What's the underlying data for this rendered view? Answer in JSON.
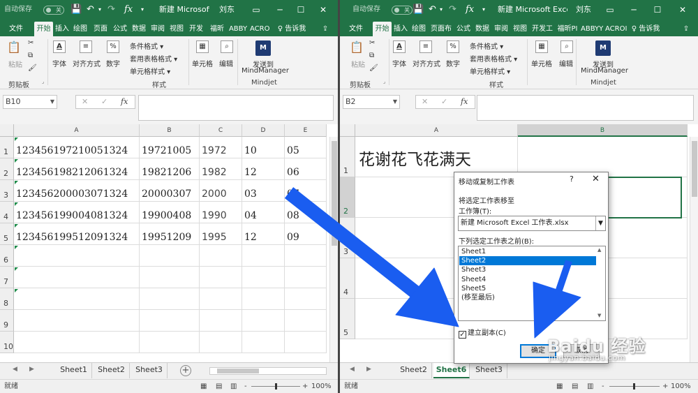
{
  "left": {
    "title": {
      "autosave": "自动保存",
      "toggle": "关",
      "save_icon": "save-icon",
      "undo": "↶",
      "undo_dd": "▾",
      "redo": "↷",
      "fx": "fx",
      "more": "▾",
      "doc": "新建 Microsoft",
      "user": "刘东",
      "win_opts": "▭",
      "minimize": "─",
      "maximize": "☐",
      "close": "✕"
    },
    "tabs": [
      {
        "label": "文件"
      },
      {
        "label": "开始"
      },
      {
        "label": "插入"
      },
      {
        "label": "绘图"
      },
      {
        "label": "页面"
      },
      {
        "label": "公式"
      },
      {
        "label": "数据"
      },
      {
        "label": "审阅"
      },
      {
        "label": "视图"
      },
      {
        "label": "开发"
      },
      {
        "label": "福昕"
      },
      {
        "label": "ABBY"
      },
      {
        "label": "ACRO"
      }
    ],
    "tell_me": "♀ 告诉我",
    "share_icon": "⇪",
    "ribbon": {
      "paste": "粘贴",
      "clipboard": "剪贴板",
      "font": "字体",
      "align": "对齐方式",
      "number": "数字",
      "cond_fmt": "条件格式 ▾",
      "table_fmt": "套用表格格式 ▾",
      "cell_style": "单元格样式 ▾",
      "styles": "样式",
      "cells": "单元格",
      "edit": "编辑",
      "send_line1": "发送到",
      "send_line2": "MindManager",
      "mindjet": "Mindjet"
    },
    "formula": {
      "namebox": "B10",
      "cancel": "✕",
      "enter": "✓",
      "fx": "fx"
    },
    "columns": [
      "A",
      "B",
      "C",
      "D",
      "E"
    ],
    "rows": [
      "1",
      "2",
      "3",
      "4",
      "5",
      "6",
      "7",
      "8",
      "9",
      "10"
    ],
    "cells": [
      [
        "123456197210051324",
        "19721005",
        "1972",
        "10",
        "05"
      ],
      [
        "123456198212061324",
        "19821206",
        "1982",
        "12",
        "06"
      ],
      [
        "123456200003071324",
        "20000307",
        "2000",
        "03",
        "07"
      ],
      [
        "123456199004081324",
        "19900408",
        "1990",
        "04",
        "08"
      ],
      [
        "123456199512091324",
        "19951209",
        "1995",
        "12",
        "09"
      ]
    ],
    "sheets": [
      "Sheet1",
      "Sheet2",
      "Sheet3"
    ],
    "nav_prev": "◀",
    "nav_next": "▶",
    "add_sheet": "+",
    "status": {
      "ready": "就绪",
      "zoom": "100%",
      "minus": "-",
      "plus": "+"
    }
  },
  "right": {
    "title": {
      "autosave": "自动保存",
      "toggle": "关",
      "undo": "↶",
      "undo_dd": "▾",
      "redo": "↷",
      "fx": "fx",
      "more": "▾",
      "doc": "新建 Microsoft Exce…",
      "user": "刘东",
      "win_opts": "▭",
      "minimize": "─",
      "maximize": "☐",
      "close": "✕"
    },
    "tabs": [
      {
        "label": "文件"
      },
      {
        "label": "开始"
      },
      {
        "label": "插入"
      },
      {
        "label": "绘图"
      },
      {
        "label": "页面布"
      },
      {
        "label": "公式"
      },
      {
        "label": "数据"
      },
      {
        "label": "审阅"
      },
      {
        "label": "视图"
      },
      {
        "label": "开发工"
      },
      {
        "label": "福昕PI"
      },
      {
        "label": "ABBYY"
      },
      {
        "label": "ACROI"
      }
    ],
    "tell_me": "♀ 告诉我",
    "share_icon": "⇪",
    "ribbon": {
      "paste": "粘贴",
      "clipboard": "剪贴板",
      "font": "字体",
      "align": "对齐方式",
      "number": "数字",
      "cond_fmt": "条件格式 ▾",
      "table_fmt": "套用表格格式 ▾",
      "cell_style": "单元格样式 ▾",
      "styles": "样式",
      "cells": "单元格",
      "edit": "编辑",
      "send_line1": "发送到",
      "send_line2": "MindManager",
      "mindjet": "Mindjet"
    },
    "formula": {
      "namebox": "B2",
      "cancel": "✕",
      "enter": "✓",
      "fx": "fx"
    },
    "columns": [
      "A",
      "B"
    ],
    "rows": [
      "1",
      "2",
      "3",
      "4",
      "5"
    ],
    "a1": "花谢花飞花满天",
    "sheets": [
      "Sheet2",
      "Sheet6",
      "Sheet3"
    ],
    "nav_prev": "◀",
    "nav_next": "▶",
    "status": {
      "ready": "就绪",
      "zoom": "100%",
      "minus": "-",
      "plus": "+"
    }
  },
  "dialog": {
    "title": "移动或复制工作表",
    "help": "?",
    "close": "✕",
    "move_to": "将选定工作表移至",
    "workbook_label": "工作簿(T):",
    "workbook_value": "新建 Microsoft Excel 工作表.xlsx",
    "before_label": "下列选定工作表之前(B):",
    "items": [
      "Sheet1",
      "Sheet2",
      "Sheet3",
      "Sheet4",
      "Sheet5",
      "(移至最后)"
    ],
    "selected_index": 1,
    "checkbox_label": "建立副本(C)",
    "checkbox_checked": true,
    "check_mark": "✓",
    "ok": "确定",
    "cancel": "取消"
  },
  "watermark": {
    "brand": "Baidu 经验",
    "url": "jingyan.baidu.com"
  },
  "colors": {
    "excel_green": "#217346",
    "arrow_blue": "#1a5df0",
    "selection_blue": "#0078d7"
  }
}
